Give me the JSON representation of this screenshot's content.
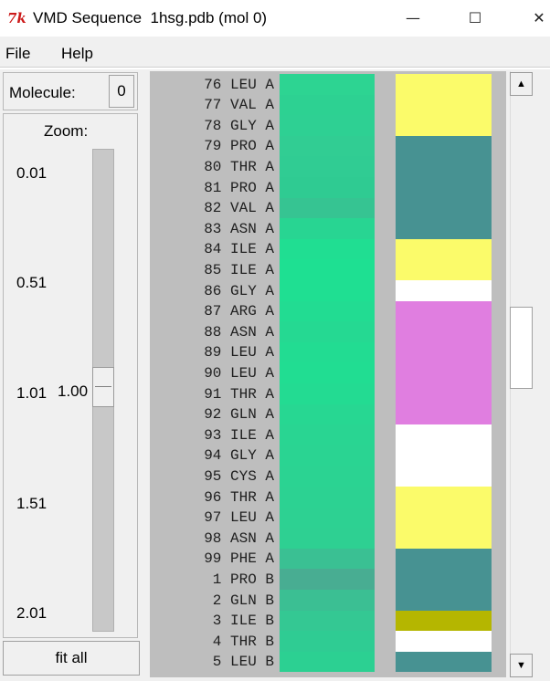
{
  "window": {
    "icon": "tk-icon",
    "icon_text": "7k",
    "title": "VMD Sequence  1hsg.pdb (mol 0)",
    "minimize": "—",
    "maximize": "☐",
    "close": "✕"
  },
  "menu": {
    "file": "File",
    "help": "Help"
  },
  "molecule": {
    "label": "Molecule:",
    "value": "0"
  },
  "zoom": {
    "label": "Zoom:",
    "ticks": [
      "0.01",
      "0.51",
      "1.01",
      "1.51",
      "2.01"
    ],
    "value": "1.00",
    "value_fraction": 0.495
  },
  "fit_all": "fit all",
  "colors": {
    "strand": "#fbfb6a",
    "coil": "#479292",
    "turn": "#ffffff",
    "helix": "#e07ee0",
    "bridge": "#b5b600",
    "bfactor_low": "#1fe092"
  },
  "residues": [
    {
      "label": "76 LEU A",
      "colA": "#2dd492",
      "colB": "strand"
    },
    {
      "label": "77 VAL A",
      "colA": "#2dd192",
      "colB": "strand"
    },
    {
      "label": "78 GLY A",
      "colA": "#2ed093",
      "colB": "strand"
    },
    {
      "label": "79 PRO A",
      "colA": "#31cd93",
      "colB": "coil"
    },
    {
      "label": "80 THR A",
      "colA": "#30cc93",
      "colB": "coil"
    },
    {
      "label": "81 PRO A",
      "colA": "#2fcb92",
      "colB": "coil"
    },
    {
      "label": "82 VAL A",
      "colA": "#36c492",
      "colB": "coil"
    },
    {
      "label": "83 ASN A",
      "colA": "#28d592",
      "colB": "coil"
    },
    {
      "label": "84 ILE A",
      "colA": "#20de92",
      "colB": "strand"
    },
    {
      "label": "85 ILE A",
      "colA": "#1ee092",
      "colB": "strand"
    },
    {
      "label": "86 GLY A",
      "colA": "#1fdf92",
      "colB": "turn"
    },
    {
      "label": "87 ARG A",
      "colA": "#22dc92",
      "colB": "helix"
    },
    {
      "label": "88 ASN A",
      "colA": "#25d992",
      "colB": "helix"
    },
    {
      "label": "89 LEU A",
      "colA": "#22dc92",
      "colB": "helix"
    },
    {
      "label": "90 LEU A",
      "colA": "#21dd92",
      "colB": "helix"
    },
    {
      "label": "91 THR A",
      "colA": "#23db92",
      "colB": "helix"
    },
    {
      "label": "92 GLN A",
      "colA": "#27d792",
      "colB": "helix"
    },
    {
      "label": "93 ILE A",
      "colA": "#29d592",
      "colB": "turn"
    },
    {
      "label": "94 GLY A",
      "colA": "#2ad492",
      "colB": "turn"
    },
    {
      "label": "95 CYS A",
      "colA": "#2bd392",
      "colB": "turn"
    },
    {
      "label": "96 THR A",
      "colA": "#2cd292",
      "colB": "strand"
    },
    {
      "label": "97 LEU A",
      "colA": "#2dd192",
      "colB": "strand"
    },
    {
      "label": "98 ASN A",
      "colA": "#2ed092",
      "colB": "strand"
    },
    {
      "label": "99 PHE A",
      "colA": "#3ac093",
      "colB": "coil"
    },
    {
      "label": "1 PRO B",
      "colA": "#48ad92",
      "colB": "coil"
    },
    {
      "label": "2 GLN B",
      "colA": "#3bbf93",
      "colB": "coil"
    },
    {
      "label": "3 ILE B",
      "colA": "#34c893",
      "colB": "bridge"
    },
    {
      "label": "4 THR B",
      "colA": "#2fcc93",
      "colB": "turn"
    },
    {
      "label": "5 LEU B",
      "colA": "#2cd092",
      "colB": "coil"
    }
  ],
  "scrollbar": {
    "up": "▲",
    "down": "▼"
  }
}
